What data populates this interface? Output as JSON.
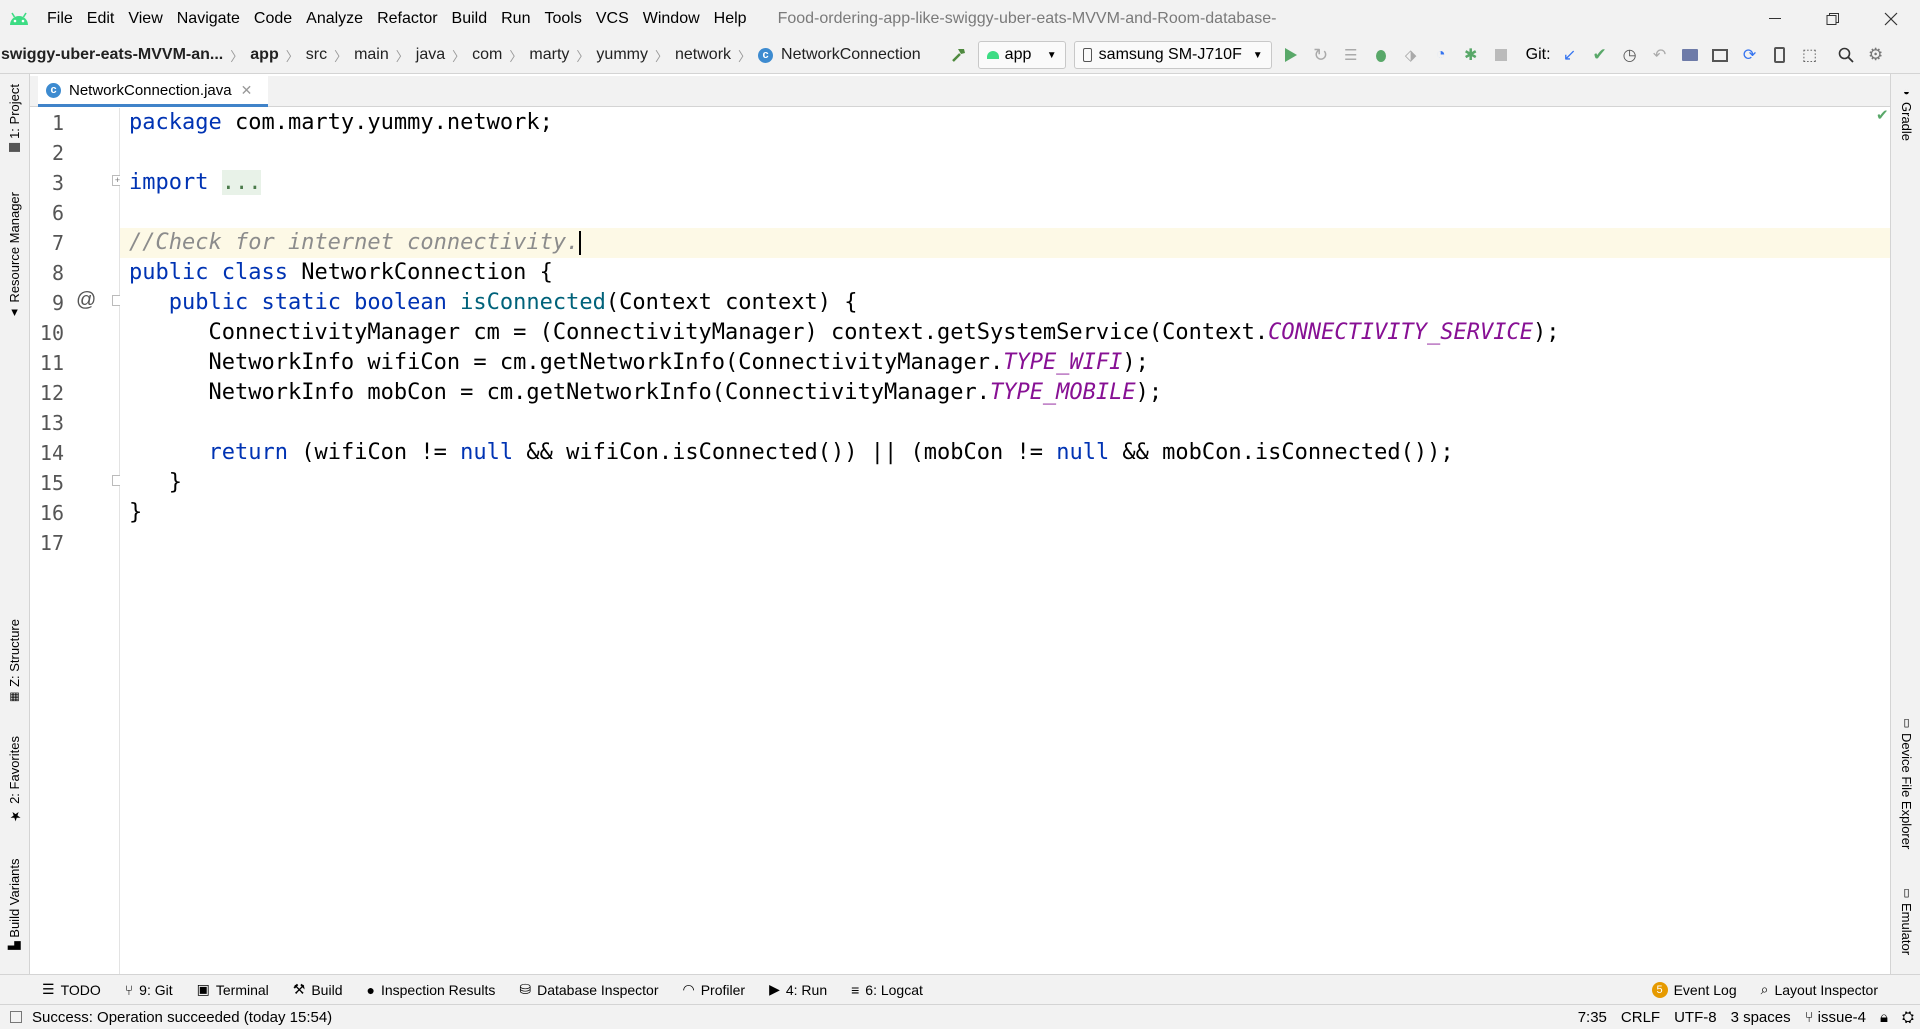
{
  "app": {
    "menu": [
      "File",
      "Edit",
      "View",
      "Navigate",
      "Code",
      "Analyze",
      "Refactor",
      "Build",
      "Run",
      "Tools",
      "VCS",
      "Window",
      "Help"
    ],
    "window_title": "Food-ordering-app-like-swiggy-uber-eats-MVVM-and-Room-database-"
  },
  "nav": {
    "breadcrumbs": [
      "swiggy-uber-eats-MVVM-an...",
      "app",
      "src",
      "main",
      "java",
      "com",
      "marty",
      "yummy",
      "network",
      "NetworkConnection"
    ],
    "run_config": "app",
    "device": "samsung SM-J710F",
    "git_label": "Git:"
  },
  "editor_tab": {
    "filename": "NetworkConnection.java"
  },
  "left_tools": [
    "1: Project",
    "Resource Manager",
    "Z: Structure",
    "2: Favorites",
    "Build Variants"
  ],
  "right_tools": [
    "Gradle",
    "Device File Explorer",
    "Emulator"
  ],
  "line_numbers": [
    "1",
    "2",
    "3",
    "6",
    "7",
    "8",
    "9",
    "10",
    "11",
    "12",
    "13",
    "14",
    "15",
    "16",
    "17"
  ],
  "code": {
    "l1_kw": "package",
    "l1_rest": " com.marty.yummy.network;",
    "l3_kw": "import",
    "l3_fold": "...",
    "l7_comment": "//Check for internet connectivity.",
    "l8_kw": "public class",
    "l8_rest": " NetworkConnection {",
    "l9_kw": "public static boolean",
    "l9_fn": "isConnected",
    "l9_rest": "(Context context) {",
    "l10_a": "ConnectivityManager cm = (ConnectivityManager) context.getSystemService(Context.",
    "l10_c": "CONNECTIVITY_SERVICE",
    "l10_b": ");",
    "l11_a": "NetworkInfo wifiCon = cm.getNetworkInfo(ConnectivityManager.",
    "l11_c": "TYPE_WIFI",
    "l11_b": ");",
    "l12_a": "NetworkInfo mobCon = cm.getNetworkInfo(ConnectivityManager.",
    "l12_c": "TYPE_MOBILE",
    "l12_b": ");",
    "l14_kw": "return",
    "l14_a": " (wifiCon != ",
    "l14_null1": "null",
    "l14_b": " && wifiCon.isConnected()) || (mobCon != ",
    "l14_null2": "null",
    "l14_c": " && mobCon.isConnected());",
    "l15": "}",
    "l16": "}"
  },
  "gutter_marker": "@",
  "bottom_tabs": [
    "TODO",
    "9: Git",
    "Terminal",
    "Build",
    "Inspection Results",
    "Database Inspector",
    "Profiler",
    "4: Run",
    "6: Logcat"
  ],
  "bottom_right_tabs": [
    "Event Log",
    "Layout Inspector"
  ],
  "event_badge": "5",
  "status": {
    "message": "Success: Operation succeeded (today 15:54)",
    "position": "7:35",
    "line_sep": "CRLF",
    "encoding": "UTF-8",
    "indent": "3 spaces",
    "branch": "issue-4"
  },
  "colors": {
    "accent": "#4083c9",
    "keyword": "#0033b3",
    "constant": "#871094",
    "comment": "#8c8c8c"
  }
}
